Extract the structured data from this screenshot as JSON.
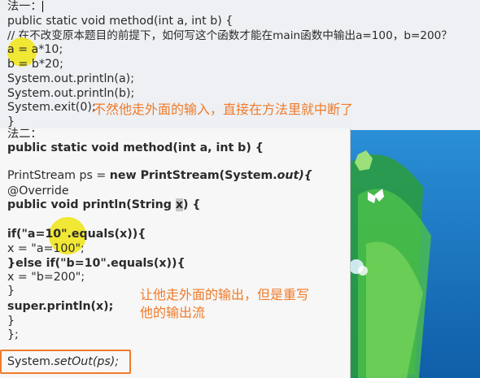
{
  "method1": {
    "header": "法一：",
    "lines": [
      "public static void method(int a, int b) {",
      "// 在不改变原本题目的前提下，如何写这个函数才能在main函数中输出a=100，b=200？",
      "a = a*10;",
      "b = b*20;",
      "System.out.println(a);",
      "System.out.println(b);",
      "System.exit(0);",
      "}"
    ],
    "note": "不然他走外面的输入，直接在方法里就中断了"
  },
  "method2": {
    "header": "法二：",
    "sig_kw": "public static void method(int a, int b) {",
    "ps_plain": "PrintStream ps = ",
    "ps_kw": "new PrintStream(System.",
    "ps_it": "out",
    "ps_end": "){",
    "override": "@Override",
    "println_sig": "public void println(String ",
    "println_param": "x",
    "println_end": ") {",
    "if_kw": "if(\"a=10\".equals(x)){",
    "x1": "x = \"a=100\";",
    "elseif": "}else if(\"b=10\".equals(x)){",
    "x2": "x = \"b=200\";",
    "close1": "}",
    "super": "super.println(x);",
    "close2": "}",
    "close3": "};",
    "setout_plain": "System.",
    "setout_it": "setOut(ps);",
    "note_line1": "让他走外面的输出，但是重写",
    "note_line2": "他的输出流"
  },
  "colors": {
    "annotation": "#f07a2a",
    "highlight": "#f0e62a",
    "desktop": "#1e7ec8"
  }
}
